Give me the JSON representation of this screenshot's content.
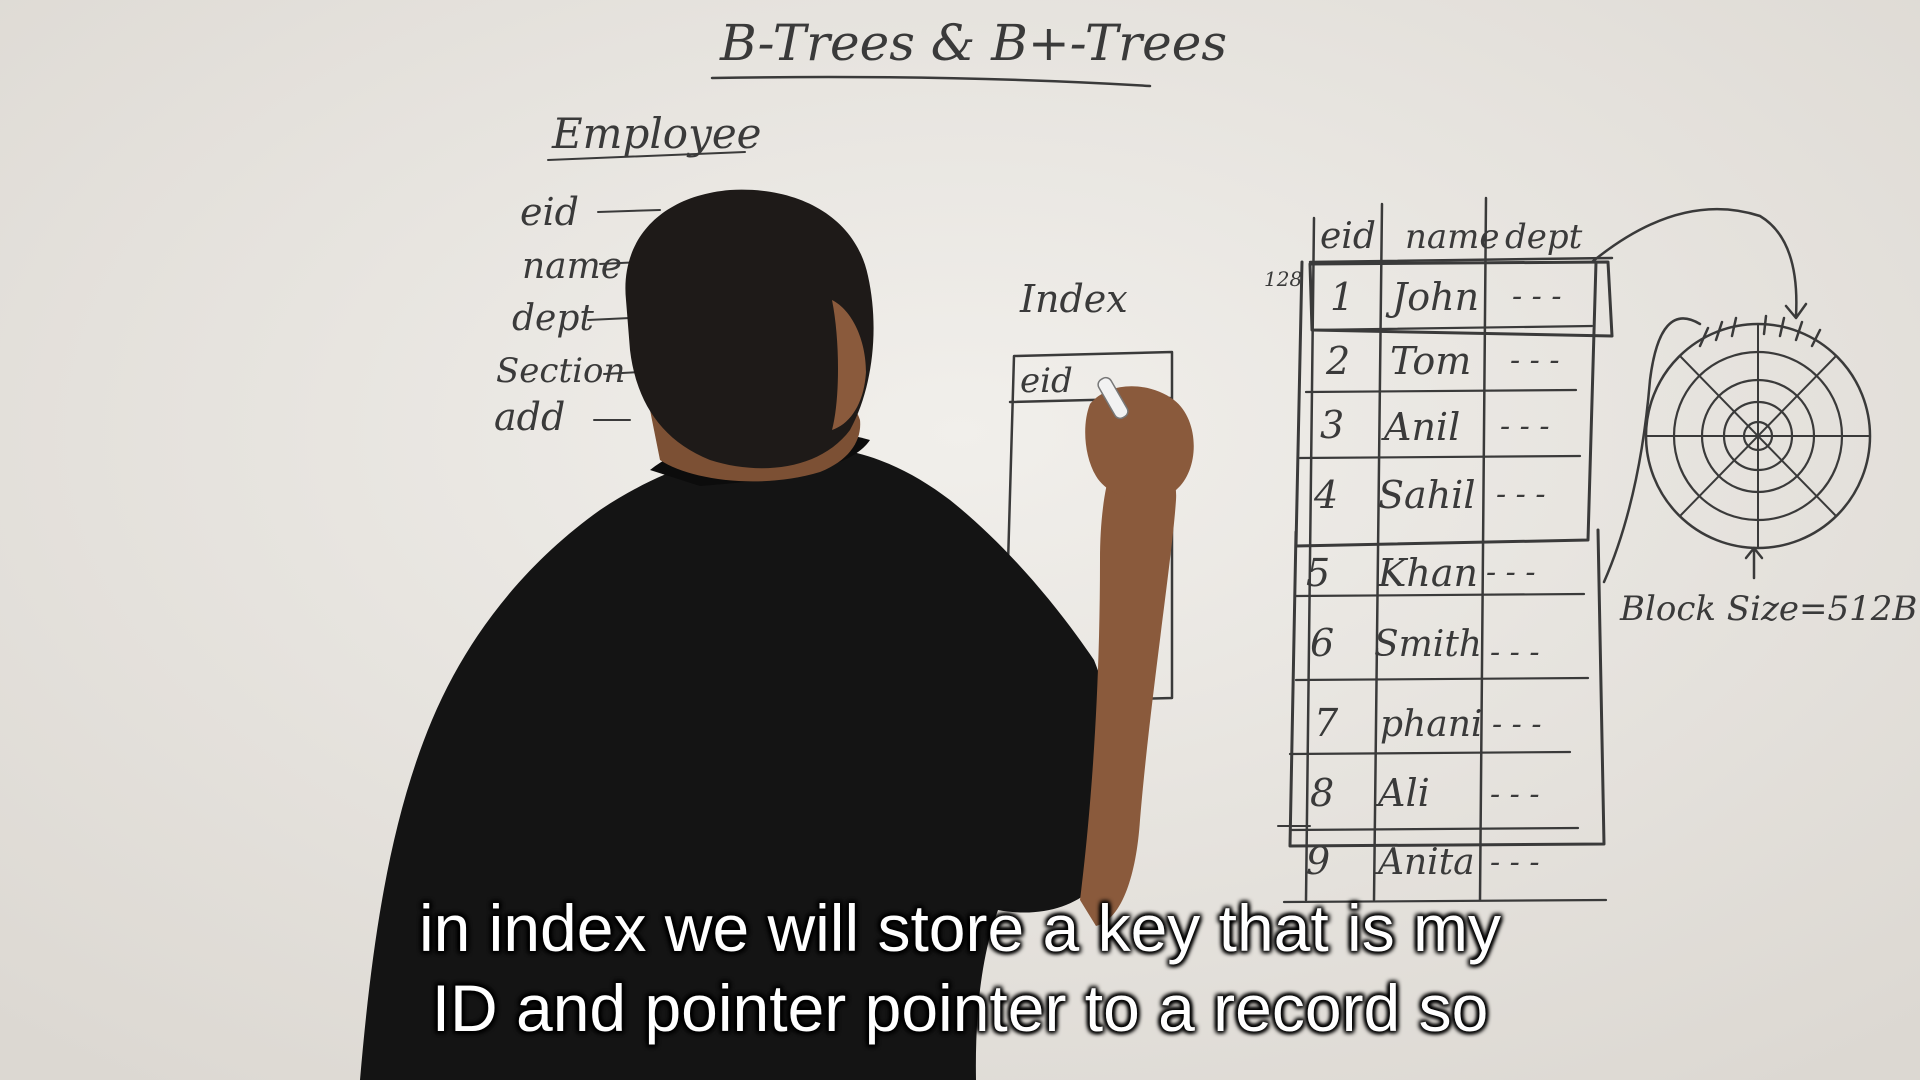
{
  "whiteboard": {
    "title": "B-Trees & B+-Trees",
    "entity_label": "Employee",
    "attributes": [
      "eid",
      "name",
      "dept",
      "Section",
      "add"
    ],
    "index_label": "Index",
    "index_column": "eid",
    "table": {
      "columns": [
        "eid",
        "name",
        "dept"
      ],
      "offset_label": "128",
      "rows": [
        {
          "eid": "1",
          "name": "John",
          "dept": "- - -"
        },
        {
          "eid": "2",
          "name": "Tom",
          "dept": "- - -"
        },
        {
          "eid": "3",
          "name": "Anil",
          "dept": "- - -"
        },
        {
          "eid": "4",
          "name": "Sahil",
          "dept": "- - -"
        },
        {
          "eid": "5",
          "name": "Khan",
          "dept": "- - -"
        },
        {
          "eid": "6",
          "name": "Smith",
          "dept": "- - -"
        },
        {
          "eid": "7",
          "name": "phani",
          "dept": "- - -"
        },
        {
          "eid": "8",
          "name": "Ali",
          "dept": "- - -"
        },
        {
          "eid": "9",
          "name": "Anita",
          "dept": "- - -"
        }
      ]
    },
    "block_size_label": "Block Size=512B"
  },
  "subtitles": {
    "line1": "in index we will store a key that is my",
    "line2": "ID and pointer pointer to a record so"
  },
  "colors": {
    "board": "#e9e6e1",
    "ink": "#3a3a3a",
    "shirt": "#141414",
    "skin": "#8a5a3c",
    "hair": "#1e1a18"
  }
}
